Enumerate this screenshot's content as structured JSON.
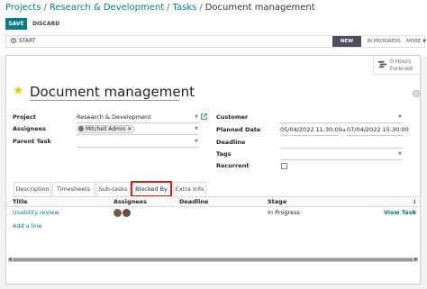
{
  "breadcrumb": {
    "projects": "Projects",
    "project": "Research & Development",
    "tasks": "Tasks",
    "current": "Document management",
    "sep": "/"
  },
  "toolbar": {
    "save": "SAVE",
    "discard": "DISCARD"
  },
  "statusbar": {
    "start": "START",
    "start_icon": "clock-icon",
    "stages": {
      "new": "NEW",
      "in_progress": "IN PROGRESS",
      "more": "MORE"
    }
  },
  "stat": {
    "value": "0 Hours",
    "label": "Forecast"
  },
  "task": {
    "title": "Document management"
  },
  "left_fields": {
    "project_label": "Project",
    "project_value": "Research & Development",
    "assignees_label": "Assignees",
    "assignee_tag": "Mitchell Admin",
    "parent_label": "Parent Task"
  },
  "right_fields": {
    "customer_label": "Customer",
    "planned_label": "Planned Date",
    "planned_start": "05/04/2022 11:30:00",
    "planned_end": "07/04/2022 15:30:00",
    "arrow": "→",
    "deadline_label": "Deadline",
    "tags_label": "Tags",
    "recurrent_label": "Recurrent"
  },
  "tabs": [
    "Description",
    "Timesheets",
    "Sub-tasks",
    "Blocked By",
    "Extra Info"
  ],
  "table": {
    "headers": {
      "title": "Title",
      "assignees": "Assignees",
      "deadline": "Deadline",
      "stage": "Stage"
    },
    "rows": [
      {
        "title": "Usability review",
        "stage": "In Progress",
        "action": "View Task"
      }
    ],
    "add_line": "Add a line"
  },
  "colors": {
    "brand": "#017e84",
    "highlight": "#d62020",
    "star": "#f3cc00"
  }
}
